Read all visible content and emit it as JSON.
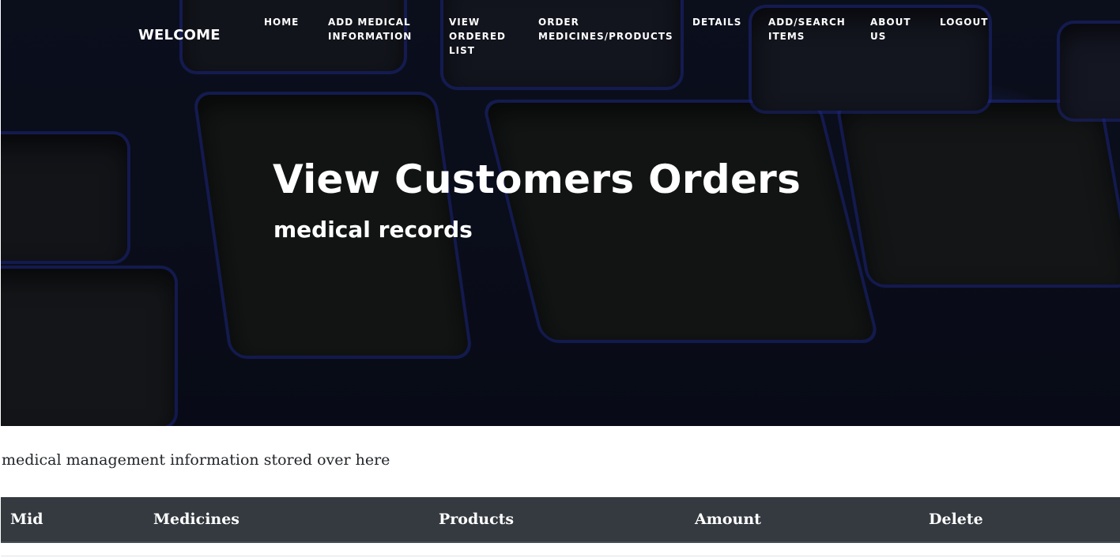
{
  "navbar": {
    "brand": "WELCOME",
    "items": [
      {
        "label": "HOME"
      },
      {
        "label": "ADD MEDICAL\nINFORMATION"
      },
      {
        "label": "VIEW\nORDERED\nLIST"
      },
      {
        "label": "ORDER\nMEDICINES/PRODUCTS"
      },
      {
        "label": "DETAILS"
      },
      {
        "label": "ADD/SEARCH\nITEMS"
      },
      {
        "label": "ABOUT\nUS"
      },
      {
        "label": "LOGOUT"
      }
    ]
  },
  "hero": {
    "title": "View Customers Orders",
    "subtitle": "medical records"
  },
  "content": {
    "intro": "medical management information stored over here"
  },
  "table": {
    "headers": [
      "Mid",
      "Medicines",
      "Products",
      "Amount",
      "Delete"
    ]
  },
  "colors": {
    "table_header_bg": "#343a40",
    "hero_accent": "#2a3cd0"
  }
}
